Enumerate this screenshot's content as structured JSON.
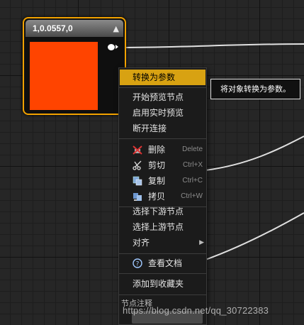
{
  "node": {
    "title": "1,0.0557,0",
    "color": "#ff4400",
    "collapse_icon": "triangle-up-icon",
    "output_pin_icon": "exec-pin-icon"
  },
  "context_menu": {
    "items": [
      {
        "label": "转换为参数",
        "highlighted": true
      },
      {
        "label": "开始预览节点"
      },
      {
        "label": "启用实时预览"
      },
      {
        "label": "断开连接"
      },
      {
        "label": "删除",
        "shortcut": "Delete",
        "icon": "delete-icon"
      },
      {
        "label": "剪切",
        "shortcut": "Ctrl+X",
        "icon": "scissors-icon"
      },
      {
        "label": "复制",
        "shortcut": "Ctrl+C",
        "icon": "copy-icon"
      },
      {
        "label": "拷贝",
        "shortcut": "Ctrl+W",
        "icon": "duplicate-icon"
      },
      {
        "label": "选择下游节点"
      },
      {
        "label": "选择上游节点"
      },
      {
        "label": "对齐",
        "submenu_icon": "chevron-right-icon"
      },
      {
        "label": "查看文档",
        "icon": "help-icon"
      },
      {
        "label": "添加到收藏夹"
      }
    ],
    "section_title": "节点注释"
  },
  "tooltip": {
    "text": "将对象转换为参数。"
  },
  "watermark": {
    "text": "https://blog.csdn.net/qq_30722383"
  },
  "colors": {
    "accent": "#d8a212",
    "node_border": "#f2a200",
    "background": "#262626"
  }
}
